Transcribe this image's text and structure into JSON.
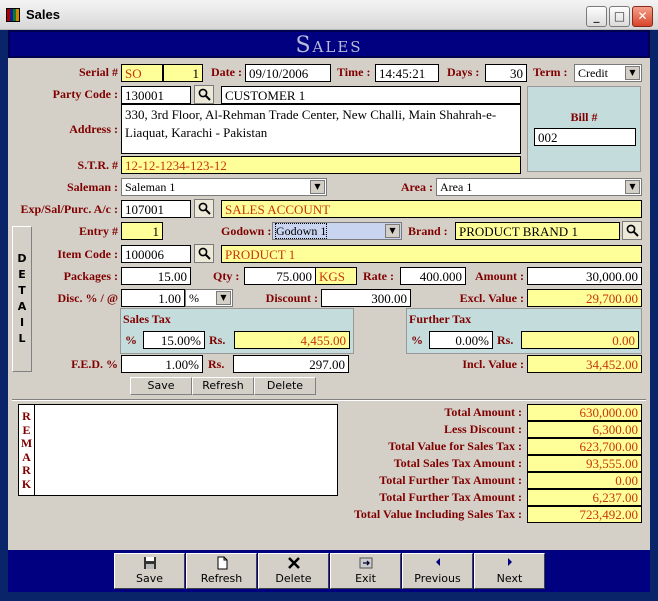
{
  "window": {
    "title": "Sales"
  },
  "header": {
    "title": "Sales"
  },
  "serial": {
    "label": "Serial #",
    "prefix": "SO",
    "number": "1"
  },
  "date": {
    "label": "Date :",
    "value": "09/10/2006"
  },
  "time": {
    "label": "Time :",
    "value": "14:45:21"
  },
  "days": {
    "label": "Days :",
    "value": "30"
  },
  "term": {
    "label": "Term :",
    "value": "Credit"
  },
  "party": {
    "label": "Party Code :",
    "code": "130001",
    "name": "CUSTOMER 1"
  },
  "address": {
    "label": "Address :",
    "value": "330, 3rd Floor, Al-Rehman Trade Center, New Challi, Main Shahrah-e-Liaquat, Karachi - Pakistan"
  },
  "bill": {
    "label": "Bill #",
    "value": "002"
  },
  "str": {
    "label": "S.T.R. #",
    "value": "12-12-1234-123-12"
  },
  "saleman": {
    "label": "Saleman :",
    "value": "Saleman 1"
  },
  "area": {
    "label": "Area :",
    "value": "Area 1"
  },
  "account": {
    "label": "Exp/Sal/Purc. A/c :",
    "code": "107001",
    "name": "SALES ACCOUNT"
  },
  "detail": {
    "tab": [
      "D",
      "E",
      "T",
      "A",
      "I",
      "L"
    ]
  },
  "entry": {
    "label": "Entry #",
    "value": "1"
  },
  "godown": {
    "label": "Godown :",
    "value": "Godown 1"
  },
  "brand": {
    "label": "Brand :",
    "value": "PRODUCT BRAND 1"
  },
  "item": {
    "label": "Item Code :",
    "code": "100006",
    "name": "PRODUCT 1"
  },
  "packages": {
    "label": "Packages :",
    "value": "15.00"
  },
  "qty": {
    "label": "Qty :",
    "value": "75.000",
    "unit": "KGS"
  },
  "rate": {
    "label": "Rate :",
    "value": "400.000"
  },
  "amount": {
    "label": "Amount :",
    "value": "30,000.00"
  },
  "disc": {
    "label": "Disc. % / @",
    "value": "1.00",
    "type": "%"
  },
  "discount": {
    "label": "Discount :",
    "value": "300.00"
  },
  "excl": {
    "label": "Excl. Value :",
    "value": "29,700.00"
  },
  "salesTax": {
    "title": "Sales Tax",
    "pct_label": "%",
    "pct": "15.00%",
    "rs_label": "Rs.",
    "rs": "4,455.00"
  },
  "furtherTax": {
    "title": "Further Tax",
    "pct_label": "%",
    "pct": "0.00%",
    "rs_label": "Rs.",
    "rs": "0.00"
  },
  "fed": {
    "label": "F.E.D. %",
    "pct": "1.00%",
    "rs_label": "Rs.",
    "rs": "297.00"
  },
  "incl": {
    "label": "Incl. Value :",
    "value": "34,452.00"
  },
  "detailButtons": {
    "save": "Save",
    "refresh": "Refresh",
    "delete": "Delete"
  },
  "remark": {
    "tab": [
      "R",
      "E",
      "M",
      "A",
      "R",
      "K"
    ],
    "value": ""
  },
  "totals": [
    {
      "label": "Total Amount :",
      "value": "630,000.00"
    },
    {
      "label": "Less Discount :",
      "value": "6,300.00"
    },
    {
      "label": "Total Value for Sales Tax :",
      "value": "623,700.00"
    },
    {
      "label": "Total Sales Tax Amount :",
      "value": "93,555.00"
    },
    {
      "label": "Total Further Tax Amount :",
      "value": "0.00"
    },
    {
      "label": "Total Further Tax Amount :",
      "value": "6,237.00"
    },
    {
      "label": "Total Value Including Sales Tax :",
      "value": "723,492.00"
    }
  ],
  "nav": {
    "save": "Save",
    "refresh": "Refresh",
    "delete": "Delete",
    "exit": "Exit",
    "previous": "Previous",
    "next": "Next"
  },
  "colors": {
    "label": "#800000",
    "header": "#000080",
    "highlight": "#ffff99",
    "highlight_text": "#c8360c"
  }
}
